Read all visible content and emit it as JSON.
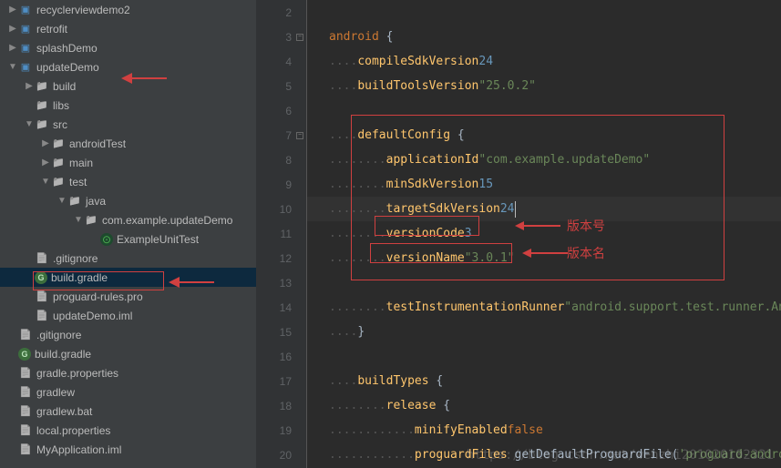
{
  "tree": [
    {
      "indent": 0,
      "arrow": "right",
      "icon": "module",
      "label": "recyclerviewdemo2"
    },
    {
      "indent": 0,
      "arrow": "right",
      "icon": "module",
      "label": "retrofit"
    },
    {
      "indent": 0,
      "arrow": "right",
      "icon": "module",
      "label": "splashDemo"
    },
    {
      "indent": 0,
      "arrow": "down",
      "icon": "module",
      "label": "updateDemo"
    },
    {
      "indent": 1,
      "arrow": "right",
      "icon": "folder",
      "label": "build"
    },
    {
      "indent": 1,
      "arrow": "none",
      "icon": "folder",
      "label": "libs"
    },
    {
      "indent": 1,
      "arrow": "down",
      "icon": "folder",
      "label": "src"
    },
    {
      "indent": 2,
      "arrow": "right",
      "icon": "folder",
      "label": "androidTest"
    },
    {
      "indent": 2,
      "arrow": "right",
      "icon": "folder",
      "label": "main"
    },
    {
      "indent": 2,
      "arrow": "down",
      "icon": "folder",
      "label": "test"
    },
    {
      "indent": 3,
      "arrow": "down",
      "icon": "folder",
      "label": "java"
    },
    {
      "indent": 4,
      "arrow": "down",
      "icon": "folder",
      "label": "com.example.updateDemo"
    },
    {
      "indent": 5,
      "arrow": "none",
      "icon": "test",
      "label": "ExampleUnitTest"
    },
    {
      "indent": 1,
      "arrow": "none",
      "icon": "file",
      "label": ".gitignore"
    },
    {
      "indent": 1,
      "arrow": "none",
      "icon": "gradle",
      "label": "build.gradle",
      "selected": true
    },
    {
      "indent": 1,
      "arrow": "none",
      "icon": "file",
      "label": "proguard-rules.pro"
    },
    {
      "indent": 1,
      "arrow": "none",
      "icon": "file",
      "label": "updateDemo.iml"
    },
    {
      "indent": 0,
      "arrow": "none",
      "icon": "file",
      "label": ".gitignore"
    },
    {
      "indent": 0,
      "arrow": "none",
      "icon": "gradle",
      "label": "build.gradle"
    },
    {
      "indent": 0,
      "arrow": "none",
      "icon": "file",
      "label": "gradle.properties"
    },
    {
      "indent": 0,
      "arrow": "none",
      "icon": "file",
      "label": "gradlew"
    },
    {
      "indent": 0,
      "arrow": "none",
      "icon": "file",
      "label": "gradlew.bat"
    },
    {
      "indent": 0,
      "arrow": "none",
      "icon": "file",
      "label": "local.properties"
    },
    {
      "indent": 0,
      "arrow": "none",
      "icon": "file",
      "label": "MyApplication.iml"
    }
  ],
  "gutter_start": 2,
  "code": {
    "l3": {
      "kw": "android",
      "text": " {"
    },
    "l4": {
      "m": "compileSdkVersion",
      "val": "24",
      "vt": "num"
    },
    "l5": {
      "m": "buildToolsVersion",
      "val": "\"25.0.2\"",
      "vt": "str"
    },
    "l7": {
      "m": "defaultConfig",
      "text": " {"
    },
    "l8": {
      "m": "applicationId",
      "val": "\"com.example.updateDemo\"",
      "vt": "str"
    },
    "l9": {
      "m": "minSdkVersion",
      "val": "15",
      "vt": "num"
    },
    "l10": {
      "m": "targetSdkVersion",
      "val": "24",
      "vt": "num"
    },
    "l11": {
      "m": "versionCode",
      "val": "3",
      "vt": "num"
    },
    "l12": {
      "m": "versionName",
      "val": "\"3.0.1\"",
      "vt": "str"
    },
    "l14": {
      "m": "testInstrumentationRunner",
      "val": "\"android.support.test.runner.Androi",
      "vt": "str"
    },
    "l15": "}",
    "l17": {
      "m": "buildTypes",
      "text": " {"
    },
    "l18": {
      "m": "release",
      "text": " {"
    },
    "l19": {
      "m": "minifyEnabled",
      "val": "false",
      "vt": "bool"
    },
    "l20": {
      "m": "proguardFiles",
      "tail": " getDefaultProguardFile(",
      "val": "'proguard-android.txt'",
      "vt": "str"
    }
  },
  "annotations": {
    "version_code_label": "版本号",
    "version_name_label": "版本名",
    "watermark": "https://blog.csdn.net/wenzhi201020102321"
  }
}
